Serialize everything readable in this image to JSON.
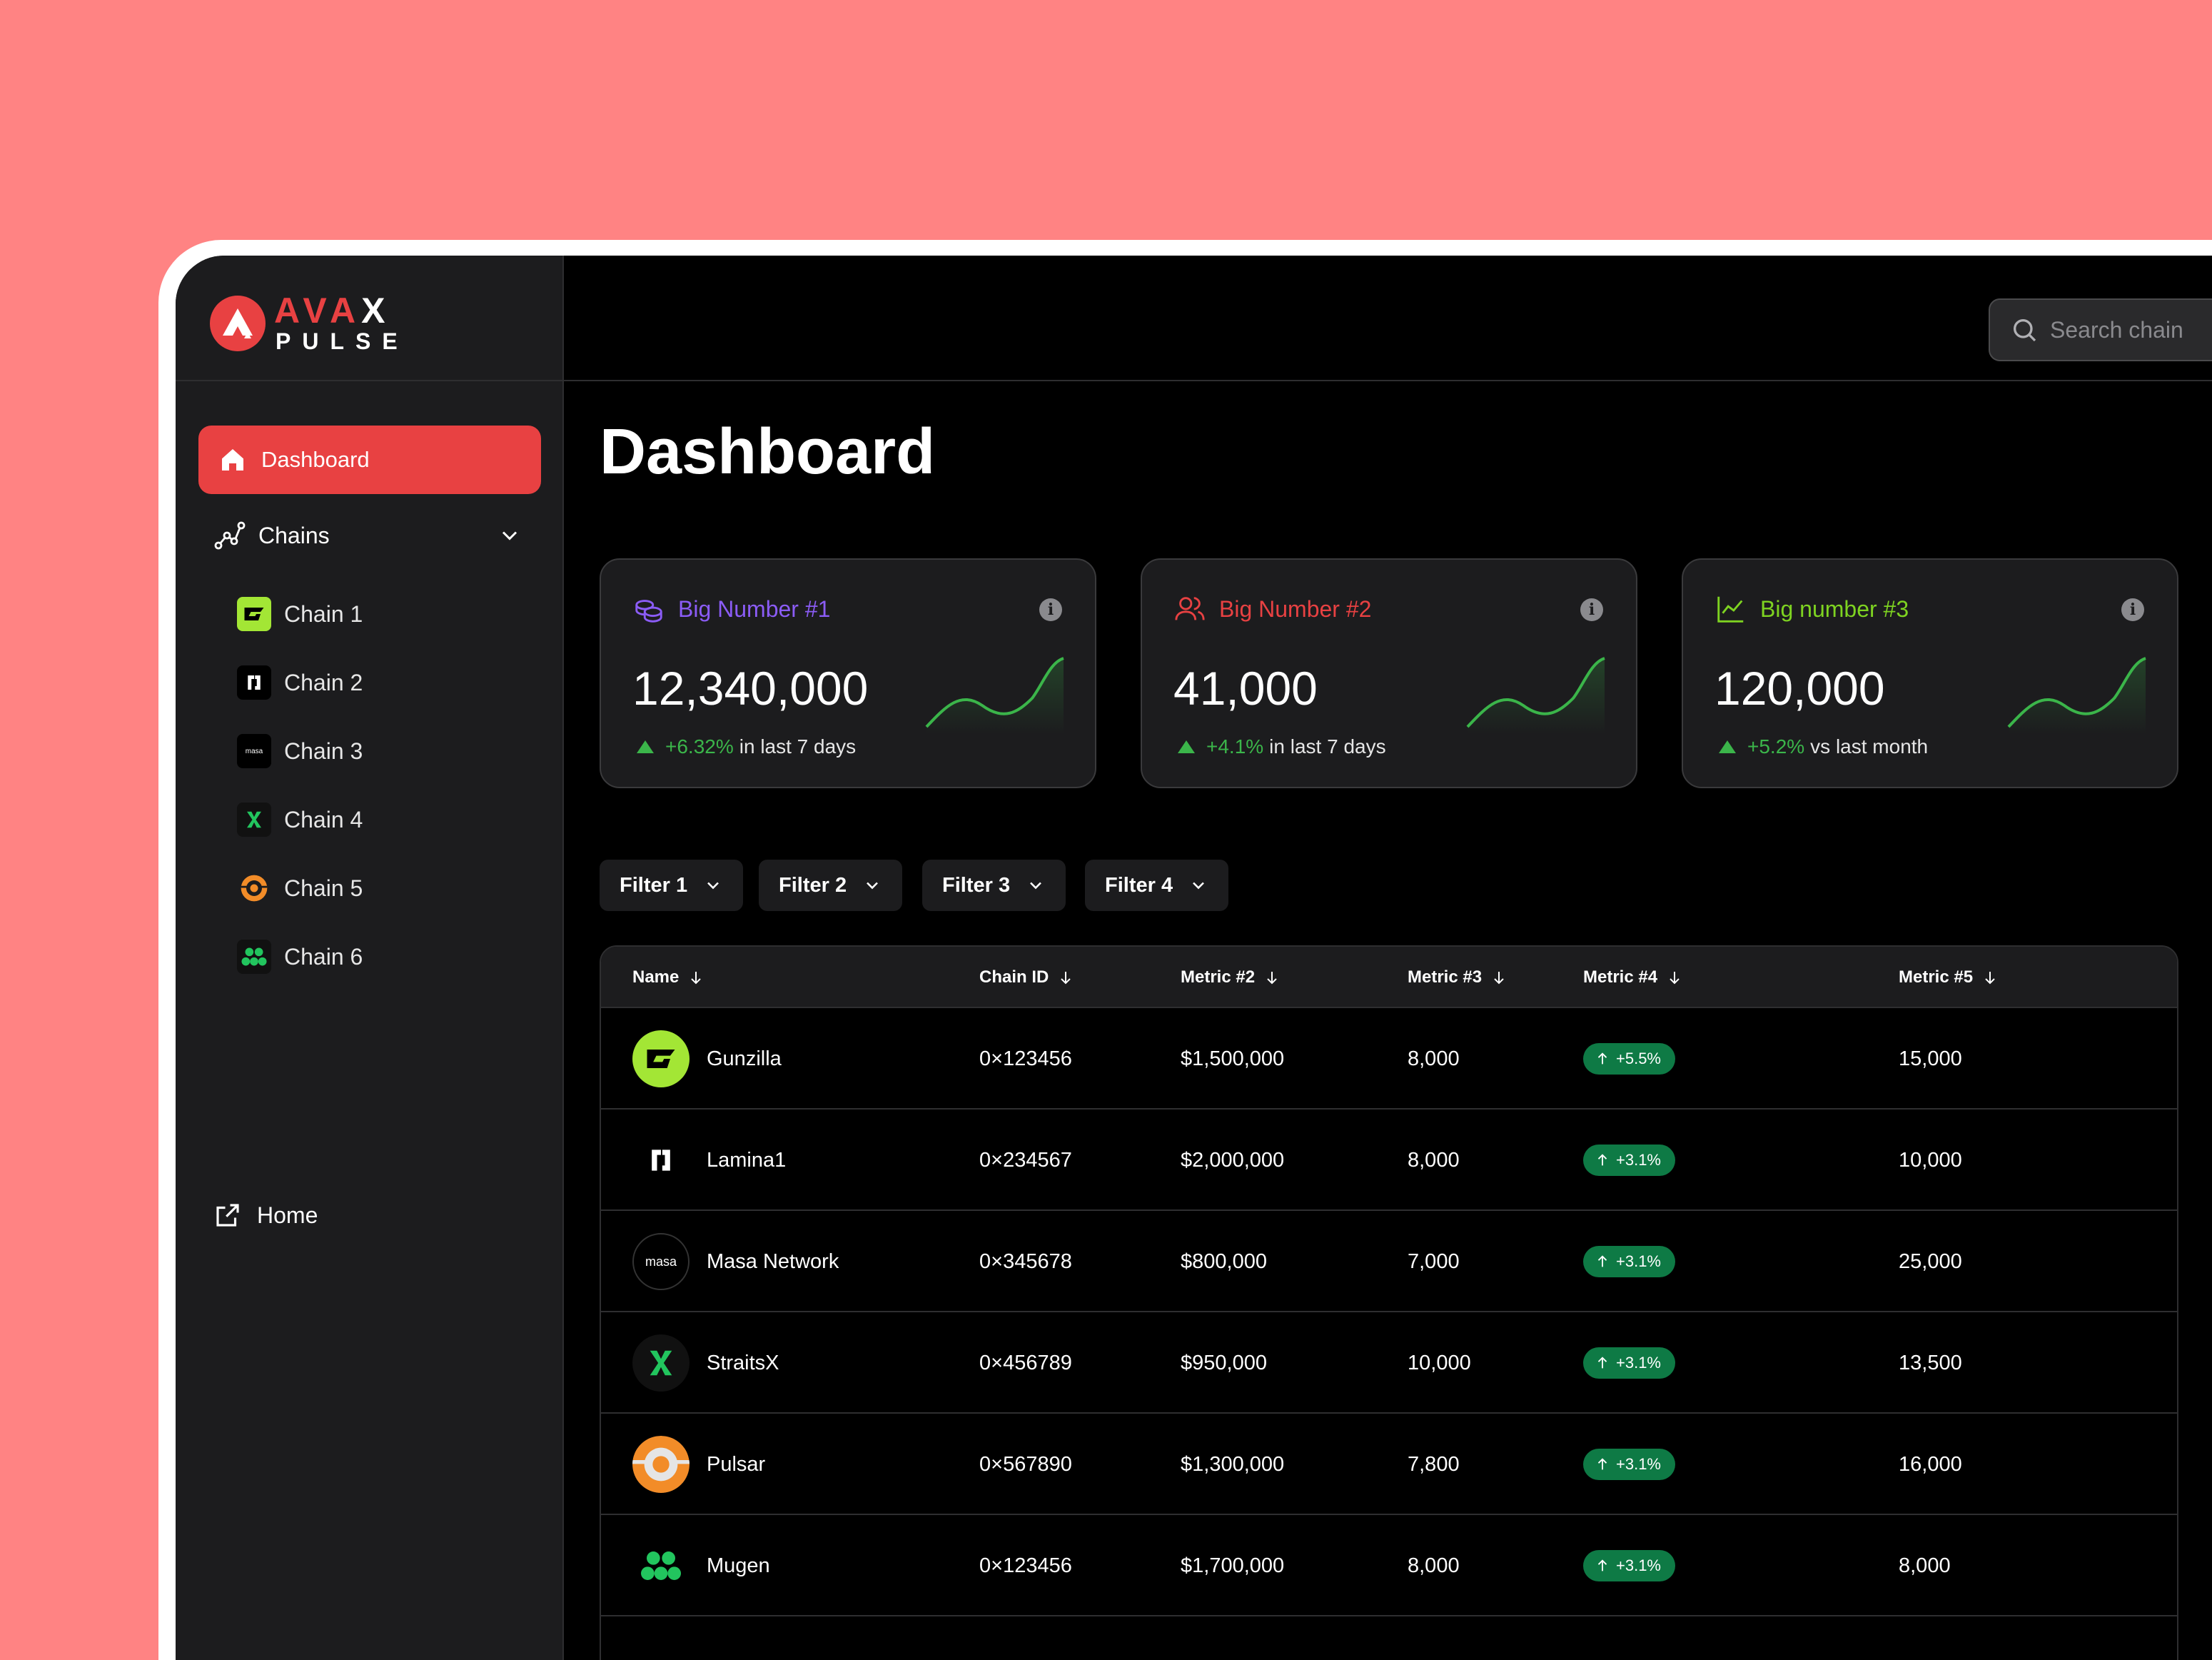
{
  "logo": {
    "top": "AVA",
    "top_x": "X",
    "bottom": "PULSE"
  },
  "sidebar": {
    "dashboard_label": "Dashboard",
    "chains_label": "Chains",
    "chains": [
      {
        "label": "Chain 1",
        "icon": "gunzilla-logo-icon"
      },
      {
        "label": "Chain 2",
        "icon": "lamina1-logo-icon"
      },
      {
        "label": "Chain 3",
        "icon": "masa-logo-icon",
        "icon_text": "masa"
      },
      {
        "label": "Chain 4",
        "icon": "straitsx-logo-icon"
      },
      {
        "label": "Chain 5",
        "icon": "pulsar-logo-icon"
      },
      {
        "label": "Chain 6",
        "icon": "mugen-logo-icon"
      }
    ],
    "home_label": "Home"
  },
  "search": {
    "placeholder": "Search chain"
  },
  "page": {
    "title": "Dashboard"
  },
  "cards": [
    {
      "title": "Big Number #1",
      "value": "12,340,000",
      "delta": "+6.32%",
      "period": "in last 7 days",
      "title_color": "#8B5CF6",
      "icon": "coins-icon"
    },
    {
      "title": "Big Number #2",
      "value": "41,000",
      "delta": "+4.1%",
      "period": "in last 7 days",
      "title_color": "#E84142",
      "icon": "users-icon"
    },
    {
      "title": "Big number #3",
      "value": "120,000",
      "delta": "+5.2%",
      "period": "vs last month",
      "title_color": "#7ED321",
      "icon": "line-chart-icon"
    }
  ],
  "filters": [
    "Filter 1",
    "Filter 2",
    "Filter 3",
    "Filter 4"
  ],
  "table": {
    "columns": [
      "Name",
      "Chain ID",
      "Metric #2",
      "Metric #3",
      "Metric #4",
      "Metric #5"
    ],
    "rows": [
      {
        "name": "Gunzilla",
        "chain_id": "0×123456",
        "m2": "$1,500,000",
        "m3": "8,000",
        "m4": "+5.5%",
        "m5": "15,000"
      },
      {
        "name": "Lamina1",
        "chain_id": "0×234567",
        "m2": "$2,000,000",
        "m3": "8,000",
        "m4": "+3.1%",
        "m5": "10,000"
      },
      {
        "name": "Masa Network",
        "chain_id": "0×345678",
        "m2": "$800,000",
        "m3": "7,000",
        "m4": "+3.1%",
        "m5": "25,000"
      },
      {
        "name": "StraitsX",
        "chain_id": "0×456789",
        "m2": "$950,000",
        "m3": "10,000",
        "m4": "+3.1%",
        "m5": "13,500"
      },
      {
        "name": "Pulsar",
        "chain_id": "0×567890",
        "m2": "$1,300,000",
        "m3": "7,800",
        "m4": "+3.1%",
        "m5": "16,000"
      },
      {
        "name": "Mugen",
        "chain_id": "0×123456",
        "m2": "$1,700,000",
        "m3": "8,000",
        "m4": "+3.1%",
        "m5": "8,000"
      }
    ]
  },
  "colors": {
    "accent": "#E84142",
    "positive": "#3BB54A",
    "badge_bg": "#0E7A45",
    "background": "#FF8383"
  }
}
